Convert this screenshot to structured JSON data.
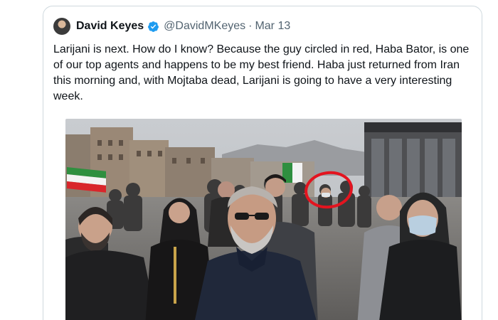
{
  "tweet": {
    "display_name": "David Keyes",
    "handle": "@DavidMKeyes",
    "separator": "·",
    "date": "Mar 13",
    "text": "Larijani is next. How do I know? Because the guy circled in red, Haba Bator, is one\nof our top agents and happens to be my best friend. Haba just returned from Iran\nthis morning and, with Mojtaba dead, Larijani is going to have a very interesting\nweek."
  },
  "colors": {
    "verified": "#1d9bf0",
    "text": "#0f1419",
    "secondary": "#536471",
    "border": "#cfd9de",
    "circle": "#e3141f"
  },
  "icons": {
    "verified": "verified-badge-icon"
  }
}
